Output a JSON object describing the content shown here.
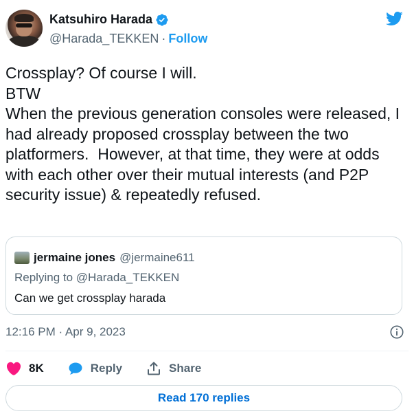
{
  "author": {
    "display_name": "Katsuhiro Harada",
    "handle": "@Harada_TEKKEN",
    "separator": "·",
    "follow_label": "Follow"
  },
  "tweet": {
    "text": "Crossplay? Of course I will.\nBTW\nWhen the previous generation consoles were released, I had already proposed crossplay between the two platformers.  However, at that time, they were at odds with each other over their mutual interests (and P2P security issue) & repeatedly refused.",
    "timestamp": "12:16 PM · Apr 9, 2023"
  },
  "quote": {
    "display_name": "jermaine jones",
    "handle": "@jermaine611",
    "replying_to": "Replying to @Harada_TEKKEN",
    "text": "Can we get crossplay harada"
  },
  "actions": {
    "like_count": "8K",
    "reply_label": "Reply",
    "share_label": "Share"
  },
  "read_replies_label": "Read 170 replies",
  "icons": {
    "brand": "twitter-bird-icon",
    "verified": "verified-badge-icon",
    "info": "info-icon",
    "like": "heart-icon",
    "reply": "reply-bubble-icon",
    "share": "share-icon"
  },
  "colors": {
    "accent": "#1d9bf0",
    "like": "#f91880",
    "text": "#0f1419",
    "muted": "#536471",
    "border": "#cfd9de"
  }
}
